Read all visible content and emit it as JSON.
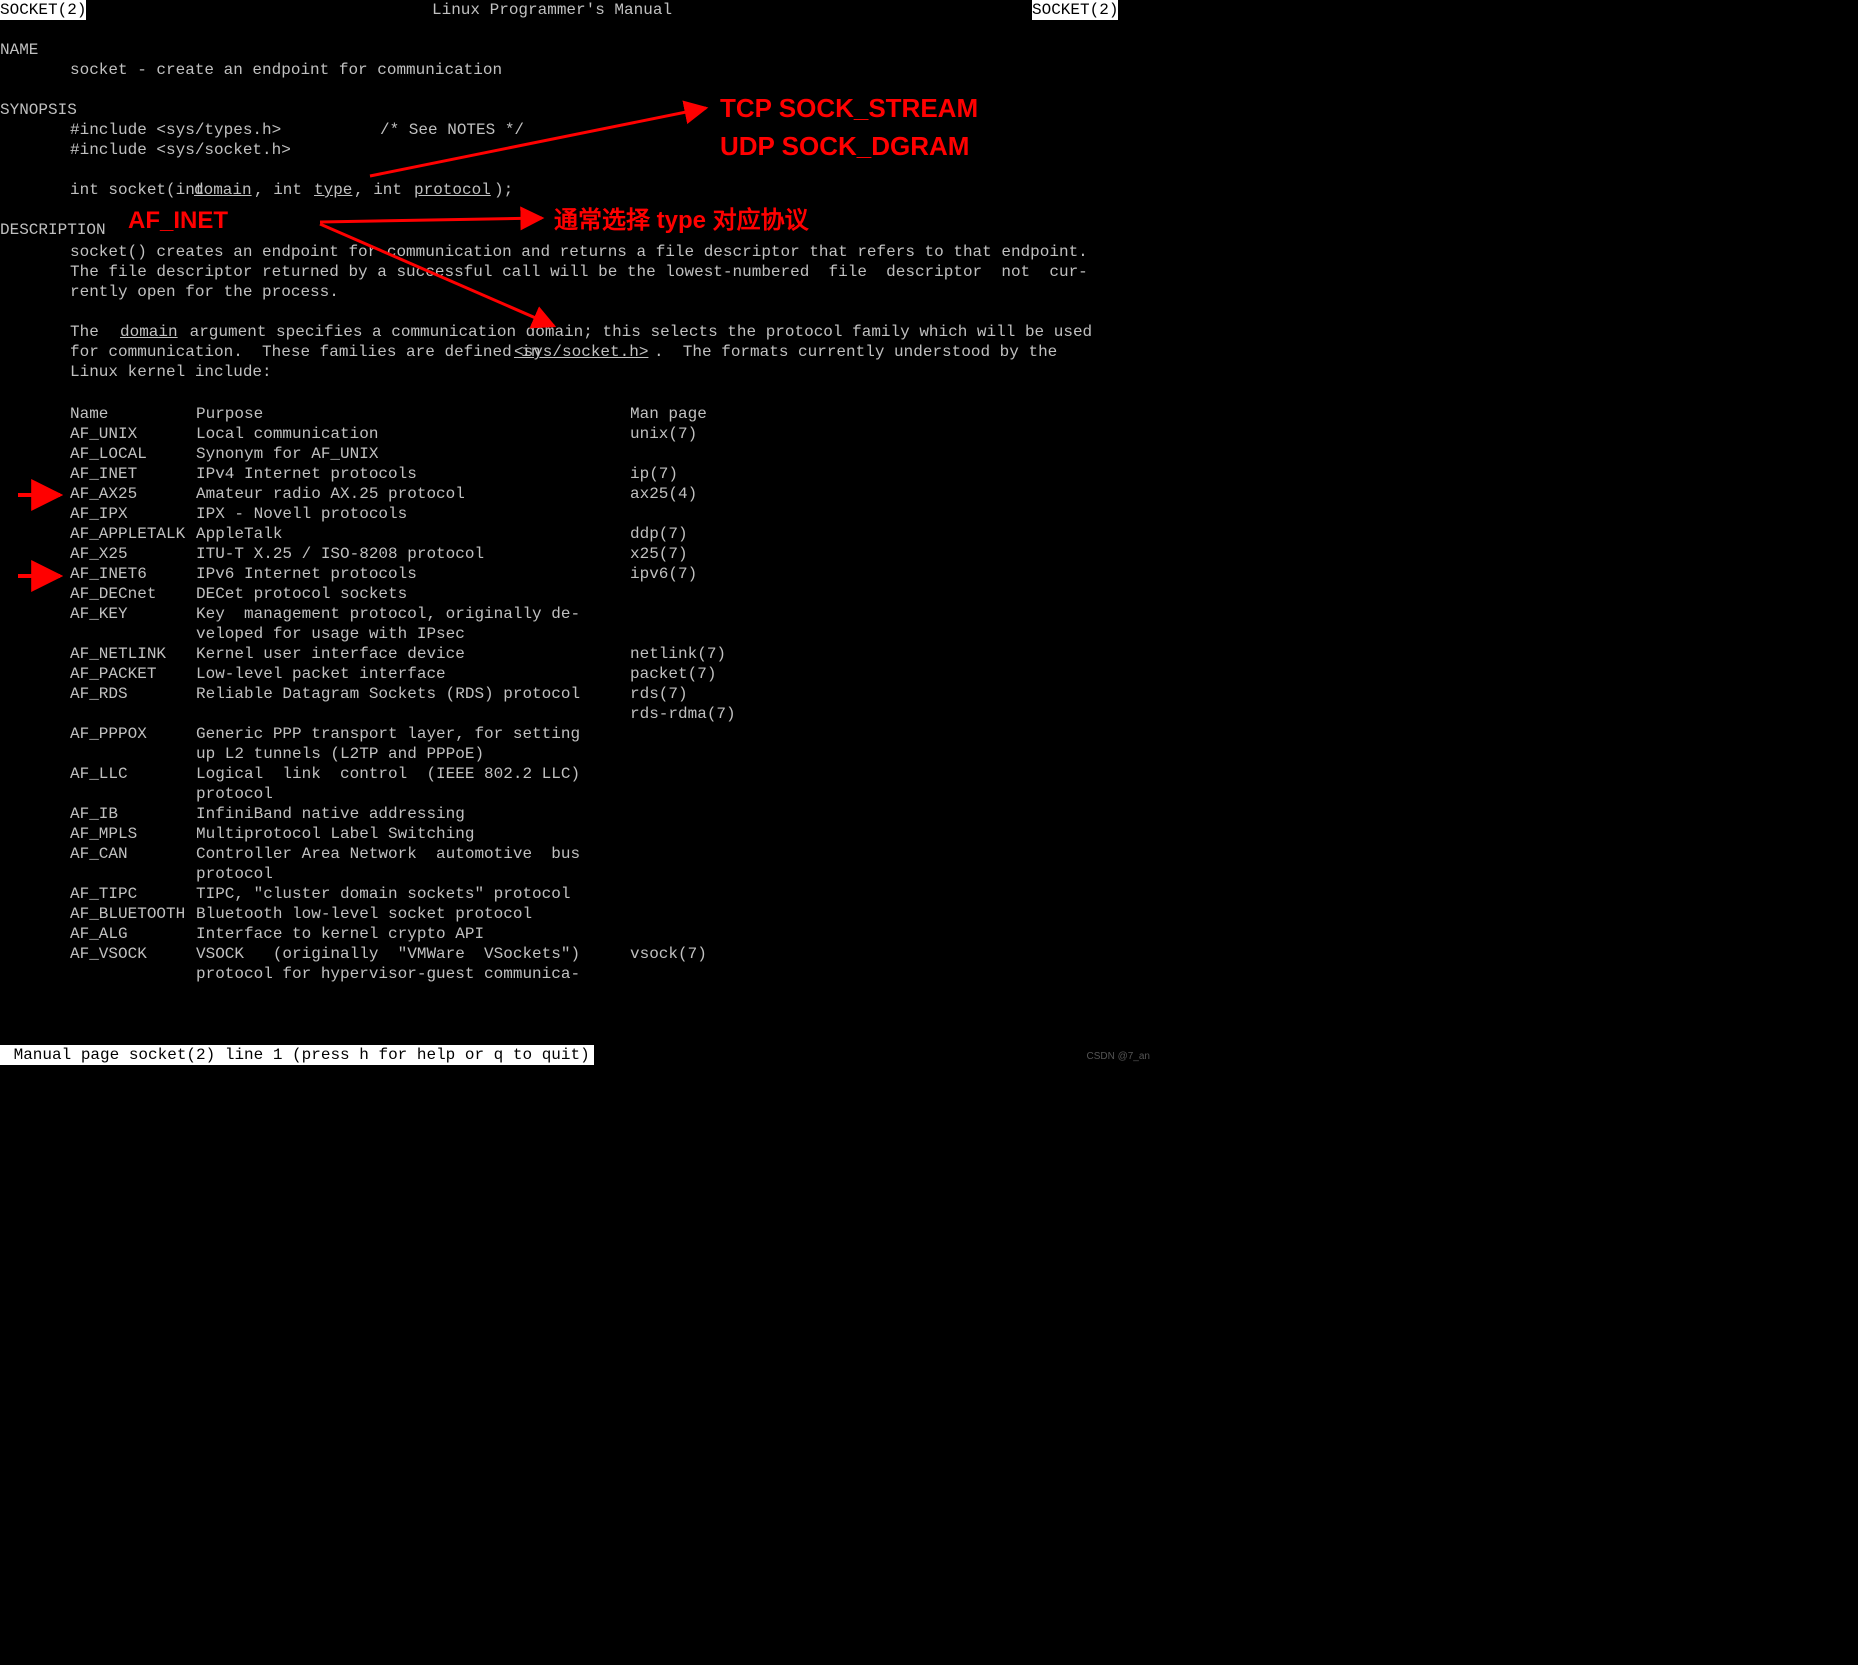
{
  "header": {
    "left": "SOCKET(2)",
    "center": "Linux Programmer's Manual",
    "right": "SOCKET(2)"
  },
  "sections": {
    "name": "NAME",
    "synopsis": "SYNOPSIS",
    "description": "DESCRIPTION"
  },
  "name_line": "socket - create an endpoint for communication",
  "synopsis": {
    "include1": "#include <sys/types.h>",
    "include1_comment": "/* See NOTES */",
    "include2": "#include <sys/socket.h>",
    "sig": {
      "p1": "int socket(int ",
      "domain": "domain",
      "p2": ", int ",
      "type": "type",
      "p3": ", int ",
      "protocol": "protocol",
      "p4": ");"
    }
  },
  "desc": {
    "p1": "socket() creates an endpoint for communication and returns a file descriptor that refers to that endpoint.\nThe file descriptor returned by a successful call will be the lowest-numbered  file  descriptor  not  cur-\nrently open for the process.",
    "p2a": "The  ",
    "domain_u": "domain",
    "p2b": " argument specifies a communication domain; this selects the protocol family which will be used",
    "p2c": "for communication.  These families are defined in ",
    "syssocket_u": "<sys/socket.h>",
    "p2d": ".  The formats currently understood by the",
    "p2e": "Linux kernel include:"
  },
  "table": {
    "header": {
      "name": "Name",
      "purpose": "Purpose",
      "man": "Man page"
    },
    "rows": [
      {
        "name": "AF_UNIX",
        "purpose": "Local communication",
        "man": "unix(7)"
      },
      {
        "name": "AF_LOCAL",
        "purpose": "Synonym for AF_UNIX",
        "man": ""
      },
      {
        "name": "AF_INET",
        "purpose": "IPv4 Internet protocols",
        "man": "ip(7)"
      },
      {
        "name": "AF_AX25",
        "purpose": "Amateur radio AX.25 protocol",
        "man": "ax25(4)"
      },
      {
        "name": "AF_IPX",
        "purpose": "IPX - Novell protocols",
        "man": ""
      },
      {
        "name": "AF_APPLETALK",
        "purpose": "AppleTalk",
        "man": "ddp(7)"
      },
      {
        "name": "AF_X25",
        "purpose": "ITU-T X.25 / ISO-8208 protocol",
        "man": "x25(7)"
      },
      {
        "name": "AF_INET6",
        "purpose": "IPv6 Internet protocols",
        "man": "ipv6(7)"
      },
      {
        "name": "AF_DECnet",
        "purpose": "DECet protocol sockets",
        "man": ""
      },
      {
        "name": "AF_KEY",
        "purpose": "Key  management protocol, originally de-\nveloped for usage with IPsec",
        "man": ""
      },
      {
        "name": "AF_NETLINK",
        "purpose": "Kernel user interface device",
        "man": "netlink(7)"
      },
      {
        "name": "AF_PACKET",
        "purpose": "Low-level packet interface",
        "man": "packet(7)"
      },
      {
        "name": "AF_RDS",
        "purpose": "Reliable Datagram Sockets (RDS) protocol",
        "man": "rds(7)\nrds-rdma(7)"
      },
      {
        "name": "AF_PPPOX",
        "purpose": "Generic PPP transport layer, for setting\nup L2 tunnels (L2TP and PPPoE)",
        "man": ""
      },
      {
        "name": "AF_LLC",
        "purpose": "Logical  link  control  (IEEE 802.2 LLC)\nprotocol",
        "man": ""
      },
      {
        "name": "AF_IB",
        "purpose": "InfiniBand native addressing",
        "man": ""
      },
      {
        "name": "AF_MPLS",
        "purpose": "Multiprotocol Label Switching",
        "man": ""
      },
      {
        "name": "AF_CAN",
        "purpose": "Controller Area Network  automotive  bus\nprotocol",
        "man": ""
      },
      {
        "name": "AF_TIPC",
        "purpose": "TIPC, \"cluster domain sockets\" protocol",
        "man": ""
      },
      {
        "name": "AF_BLUETOOTH",
        "purpose": "Bluetooth low-level socket protocol",
        "man": ""
      },
      {
        "name": "AF_ALG",
        "purpose": "Interface to kernel crypto API",
        "man": ""
      },
      {
        "name": "AF_VSOCK",
        "purpose": "VSOCK   (originally  \"VMWare  VSockets\")\nprotocol for hypervisor-guest communica-",
        "man": "vsock(7)"
      }
    ]
  },
  "annotations": {
    "af_inet": "AF_INET",
    "tcp": "TCP  SOCK_STREAM",
    "udp": "UDP SOCK_DGRAM",
    "protocol_note": "通常选择  type 对应协议"
  },
  "status_line": " Manual page socket(2) line 1 (press h for help or q to quit)",
  "watermark": "CSDN @7_an"
}
